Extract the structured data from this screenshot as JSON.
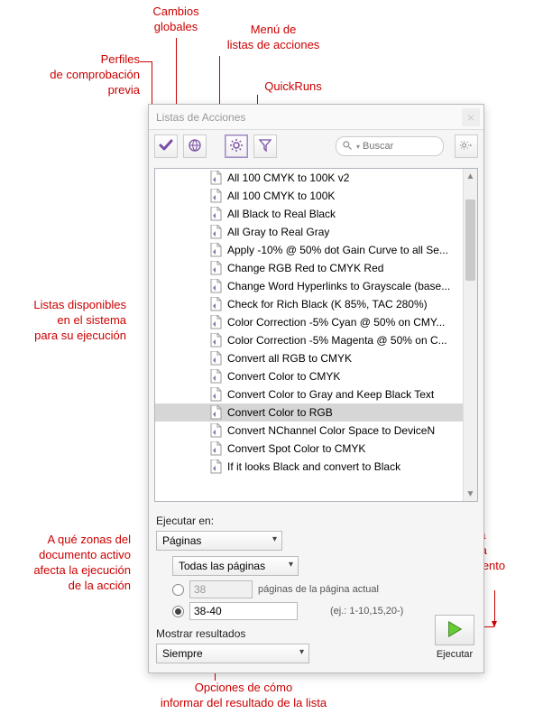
{
  "callouts": {
    "cambios_globales": "Cambios\nglobales",
    "perfiles": "Perfiles\nde comprobación\nprevia",
    "menu_listas": "Menú de\nlistas de acciones",
    "quickruns": "QuickRuns",
    "listas_disponibles": "Listas disponibles\nen el sistema\npara su ejecución",
    "a_que_zonas": "A qué zonas del\ndocumento activo\nafecta la ejecución\nde la acción",
    "ejecutar_lista": "Ejecutar lista\nseleccionada\nen el documento\nactivo",
    "opciones": "Opciones de cómo\ninformar del resultado de la lista"
  },
  "dialog": {
    "title": "Listas de Acciones",
    "search_placeholder": "Buscar",
    "toolbar": {
      "check": "preflight-check",
      "globe": "global-changes",
      "gear": "menu-action-lists",
      "filter": "quickruns",
      "settings": "settings-menu"
    }
  },
  "list": [
    "All 100 CMYK to 100K v2",
    "All 100 CMYK to 100K",
    "All Black to Real Black",
    "All Gray to Real Gray",
    "Apply -10% @ 50% dot Gain Curve to all Se...",
    "Change RGB Red to CMYK Red",
    "Change Word Hyperlinks to Grayscale (base...",
    "Check for Rich Black (K 85%, TAC 280%)",
    "Color Correction -5% Cyan @ 50% on CMY...",
    "Color Correction -5% Magenta @ 50% on C...",
    "Convert all RGB to CMYK",
    "Convert Color to CMYK",
    "Convert Color to Gray and Keep Black Text",
    "Convert Color to RGB",
    "Convert NChannel Color Space to DeviceN",
    "Convert Spot Color to CMYK",
    "If it looks Black and convert to Black"
  ],
  "selected_index": 13,
  "options": {
    "ejecutar_en": "Ejecutar en:",
    "scope_sel": "Páginas",
    "pages_sel": "Todas las páginas",
    "radio_rel_value": "38",
    "radio_rel_suffix": "páginas de la página actual",
    "radio_range_value": "38-40",
    "range_hint": "(ej.: 1-10,15,20-)",
    "mostrar_label": "Mostrar resultados",
    "mostrar_sel": "Siempre",
    "ejecutar_btn": "Ejecutar"
  }
}
